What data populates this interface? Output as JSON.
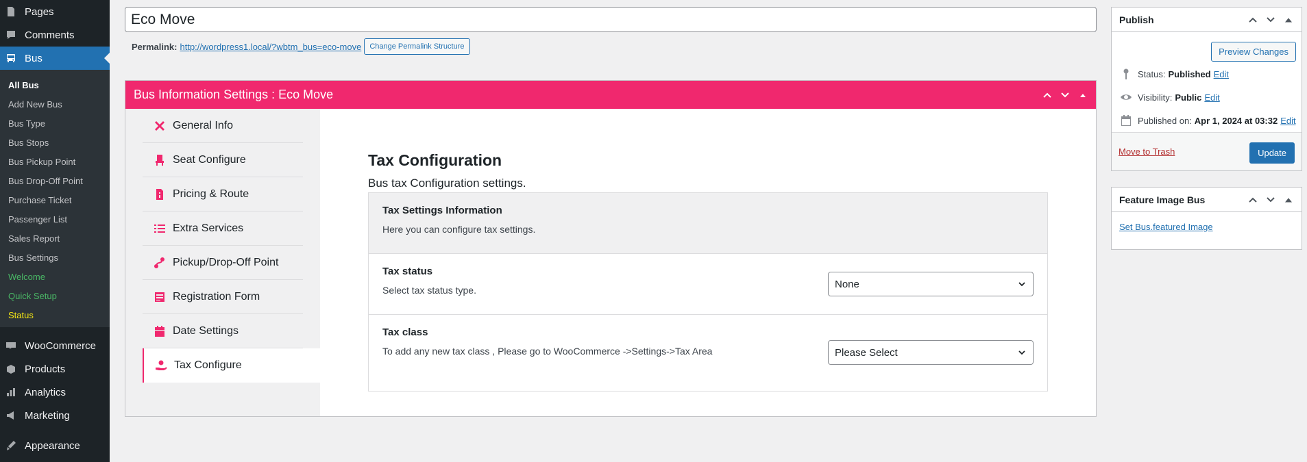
{
  "sidebar": {
    "top_items": [
      {
        "label": "Pages",
        "icon": "pages-icon"
      },
      {
        "label": "Comments",
        "icon": "comments-icon"
      },
      {
        "label": "Bus",
        "icon": "bus-icon",
        "active": true
      }
    ],
    "bus_submenu": [
      {
        "label": "All Bus",
        "current": true
      },
      {
        "label": "Add New Bus"
      },
      {
        "label": "Bus Type"
      },
      {
        "label": "Bus Stops"
      },
      {
        "label": "Bus Pickup Point"
      },
      {
        "label": "Bus Drop-Off Point"
      },
      {
        "label": "Purchase Ticket"
      },
      {
        "label": "Passenger List"
      },
      {
        "label": "Sales Report"
      },
      {
        "label": "Bus Settings"
      },
      {
        "label": "Welcome",
        "color": "#4ab866"
      },
      {
        "label": "Quick Setup",
        "color": "#4ab866"
      },
      {
        "label": "Status",
        "color": "#f5e614"
      }
    ],
    "bottom_items": [
      {
        "label": "WooCommerce",
        "icon": "woocommerce-icon"
      },
      {
        "label": "Products",
        "icon": "products-icon"
      },
      {
        "label": "Analytics",
        "icon": "analytics-icon"
      },
      {
        "label": "Marketing",
        "icon": "marketing-icon"
      },
      {
        "label": "Appearance",
        "icon": "appearance-icon"
      }
    ]
  },
  "post": {
    "title": "Eco Move",
    "permalink_label": "Permalink:",
    "permalink_url": "http://wordpress1.local/?wbtm_bus=eco-move",
    "change_permalink_button": "Change Permalink Structure"
  },
  "bus_box": {
    "title": "Bus Information Settings : Eco Move",
    "accent_color": "#f0286e",
    "tabs": [
      {
        "label": "General Info",
        "icon": "tools-icon"
      },
      {
        "label": "Seat Configure",
        "icon": "seat-icon"
      },
      {
        "label": "Pricing & Route",
        "icon": "pricing-icon"
      },
      {
        "label": "Extra Services",
        "icon": "list-icon"
      },
      {
        "label": "Pickup/Drop-Off Point",
        "icon": "route-icon"
      },
      {
        "label": "Registration Form",
        "icon": "form-icon"
      },
      {
        "label": "Date Settings",
        "icon": "calendar-icon"
      },
      {
        "label": "Tax Configure",
        "icon": "tax-hand-icon",
        "active": true
      }
    ]
  },
  "tax": {
    "heading": "Tax Configuration",
    "subheading": "Bus tax Configuration settings.",
    "info_title": "Tax Settings Information",
    "info_desc": "Here you can configure tax settings.",
    "status_title": "Tax status",
    "status_desc": "Select tax status type.",
    "status_value": "None",
    "class_title": "Tax class",
    "class_desc": "To add any new tax class , Please go to WooCommerce ->Settings->Tax Area",
    "class_value": "Please Select"
  },
  "publish": {
    "title": "Publish",
    "preview_button": "Preview Changes",
    "status_label": "Status:",
    "status_value": "Published",
    "visibility_label": "Visibility:",
    "visibility_value": "Public",
    "published_label": "Published on:",
    "published_value": "Apr 1, 2024 at 03:32",
    "edit_link": "Edit",
    "trash_link": "Move to Trash",
    "update_button": "Update"
  },
  "feature_image": {
    "title": "Feature Image Bus",
    "link": "Set Bus.featured Image"
  }
}
